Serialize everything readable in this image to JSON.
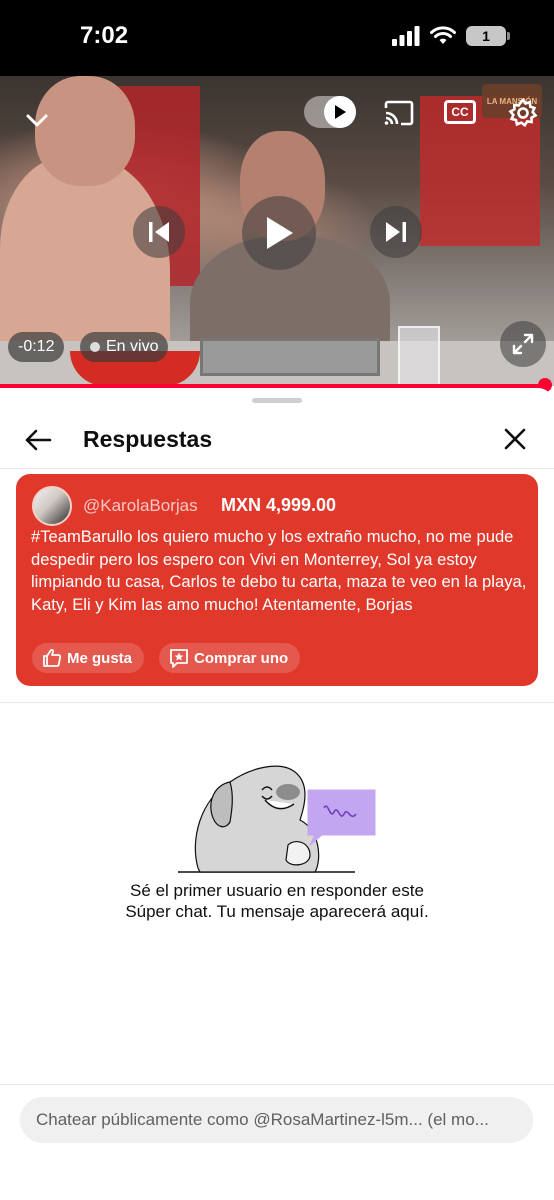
{
  "status_bar": {
    "time": "7:02",
    "battery": "1"
  },
  "player": {
    "time_remaining": "-0:12",
    "live_label": "En vivo",
    "cc_label": "CC",
    "corner_logo": "LA MANSIÓN",
    "icons": [
      "chevron-down-icon",
      "autoplay-toggle-icon",
      "cast-icon",
      "closed-captions-icon",
      "gear-icon",
      "previous-icon",
      "play-icon",
      "next-icon",
      "fullscreen-icon"
    ]
  },
  "panel": {
    "title": "Respuestas"
  },
  "superchat": {
    "username": "@KarolaBorjas",
    "amount": "MXN 4,999.00",
    "message": "#TeamBarullo los quiero mucho y los extraño mucho, no me pude despedir pero los espero con Vivi en Monterrey, Sol ya estoy limpiando tu casa, Carlos te debo tu carta, maza te veo en la playa, Katy, Eli y Kim las amo mucho! Atentamente, Borjas",
    "like_label": "Me gusta",
    "buy_label": "Comprar uno",
    "color": "#e0392b"
  },
  "empty_state": {
    "text": "Sé el primer usuario en responder este Súper chat. Tu mensaje aparecerá aquí."
  },
  "chat": {
    "placeholder": "Chatear públicamente como @RosaMartinez-l5m... (el mo..."
  },
  "colors": {
    "accent": "#ff0033"
  }
}
